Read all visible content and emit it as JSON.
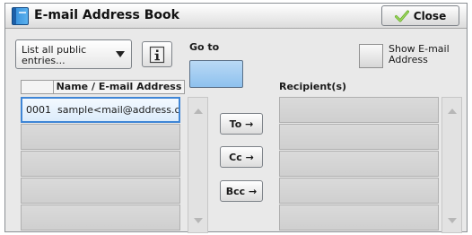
{
  "window": {
    "title": "E-mail Address Book",
    "close_label": "Close"
  },
  "filter": {
    "selected": "List all public entries..."
  },
  "goto": {
    "label": "Go to",
    "value": ""
  },
  "show_email": {
    "label": "Show E-mail Address",
    "checked": false
  },
  "address_list": {
    "header": "Name / E-mail Address",
    "rows": [
      {
        "number": "0001",
        "entry": "sample<mail@address.co.jp"
      },
      {
        "number": "",
        "entry": ""
      },
      {
        "number": "",
        "entry": ""
      },
      {
        "number": "",
        "entry": ""
      },
      {
        "number": "",
        "entry": ""
      }
    ]
  },
  "buttons": {
    "to": "To →",
    "cc": "Cc →",
    "bcc": "Bcc →"
  },
  "recipients": {
    "header": "Recipient(s)",
    "rows": [
      "",
      "",
      "",
      "",
      ""
    ]
  },
  "colors": {
    "selection_border": "#3f86d6",
    "goto_fill": "#a6cdf2",
    "check_green": "#6cb32a"
  }
}
